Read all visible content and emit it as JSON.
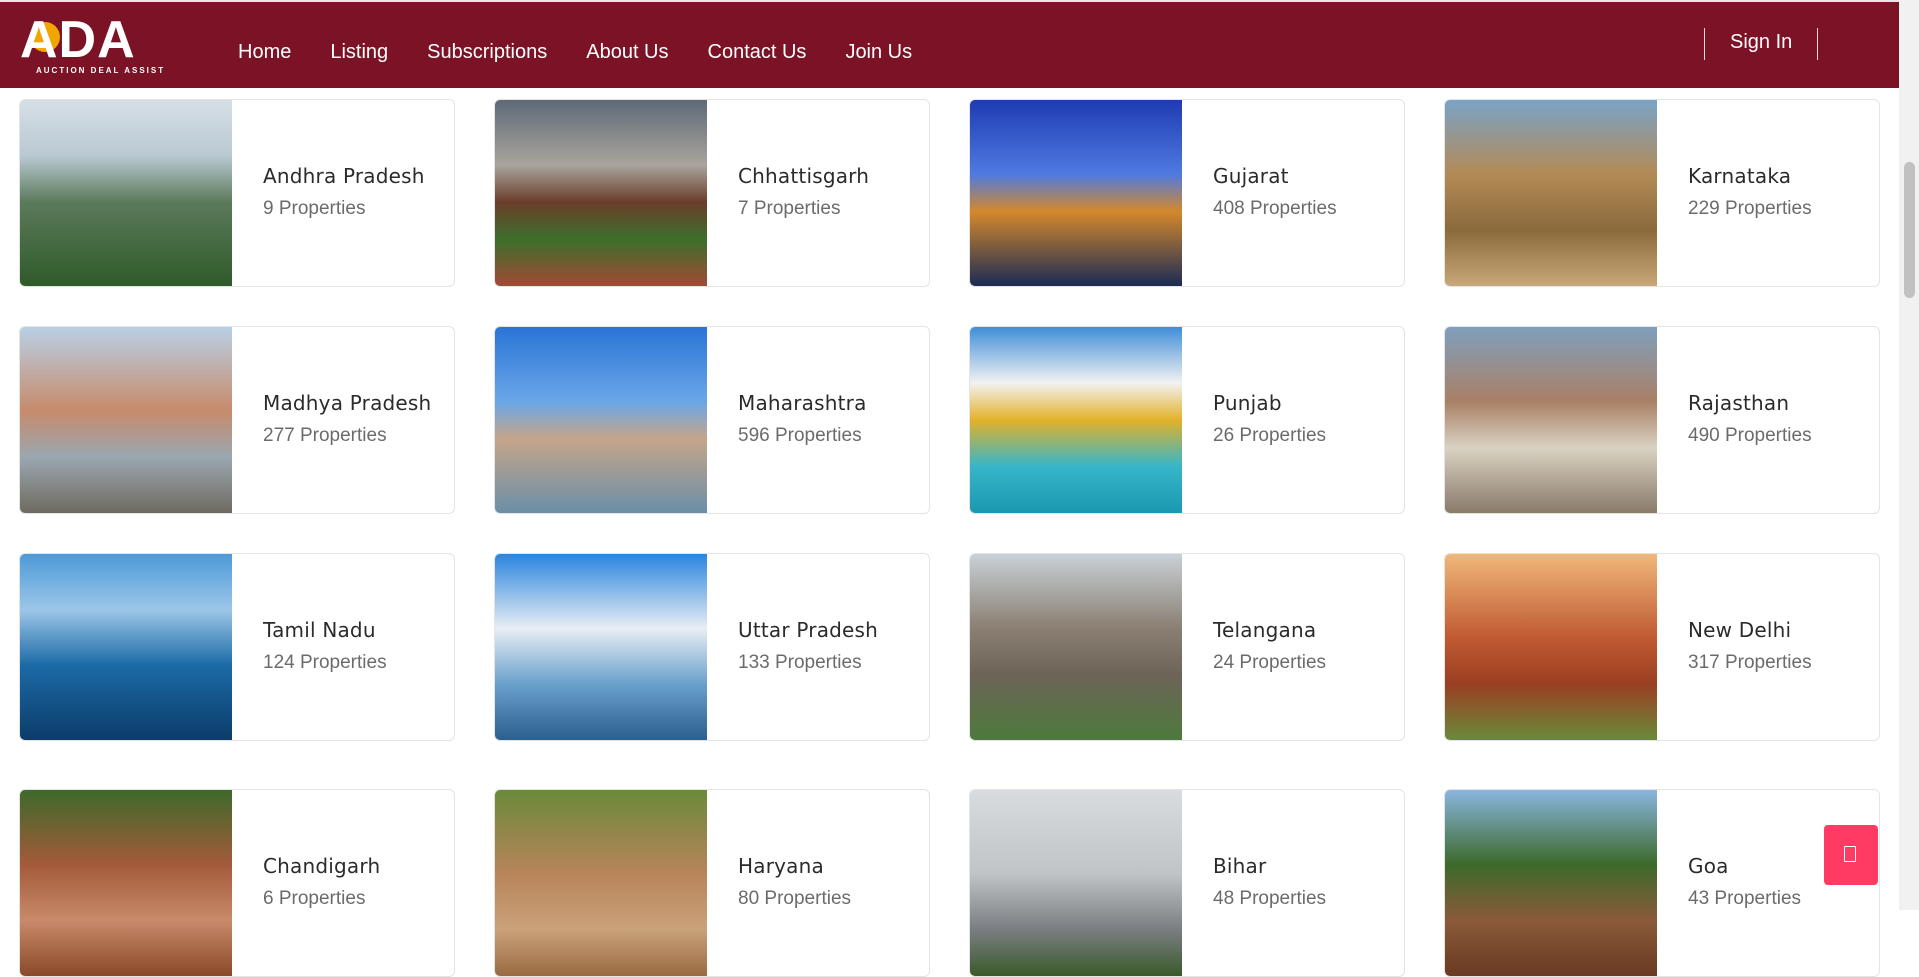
{
  "header": {
    "logo_text": "ADA",
    "logo_tagline": "AUCTION DEAL ASSIST",
    "nav": [
      "Home",
      "Listing",
      "Subscriptions",
      "About Us",
      "Contact Us",
      "Join Us"
    ],
    "sign_in": "Sign In"
  },
  "states": [
    {
      "name": "Andhra Pradesh",
      "count": "9 Properties",
      "image": "andhra"
    },
    {
      "name": "Chhattisgarh",
      "count": "7 Properties",
      "image": "chhat"
    },
    {
      "name": "Gujarat",
      "count": "408 Properties",
      "image": "guj"
    },
    {
      "name": "Karnataka",
      "count": "229 Properties",
      "image": "karn"
    },
    {
      "name": "Madhya Pradesh",
      "count": "277 Properties",
      "image": "mp"
    },
    {
      "name": "Maharashtra",
      "count": "596 Properties",
      "image": "mah"
    },
    {
      "name": "Punjab",
      "count": "26 Properties",
      "image": "pun"
    },
    {
      "name": "Rajasthan",
      "count": "490 Properties",
      "image": "raj"
    },
    {
      "name": "Tamil Nadu",
      "count": "124 Properties",
      "image": "tn"
    },
    {
      "name": "Uttar Pradesh",
      "count": "133 Properties",
      "image": "up"
    },
    {
      "name": "Telangana",
      "count": "24 Properties",
      "image": "tel"
    },
    {
      "name": "New Delhi",
      "count": "317 Properties",
      "image": "del"
    },
    {
      "name": "Chandigarh",
      "count": "6 Properties",
      "image": "cha"
    },
    {
      "name": "Haryana",
      "count": "80 Properties",
      "image": "har"
    },
    {
      "name": "Bihar",
      "count": "48 Properties",
      "image": "bih"
    },
    {
      "name": "Goa",
      "count": "43 Properties",
      "image": "goa"
    }
  ],
  "colors": {
    "header_bg": "#7b1225",
    "float_button": "#ff3b63"
  },
  "icons": {
    "float_button": "copy-icon"
  }
}
